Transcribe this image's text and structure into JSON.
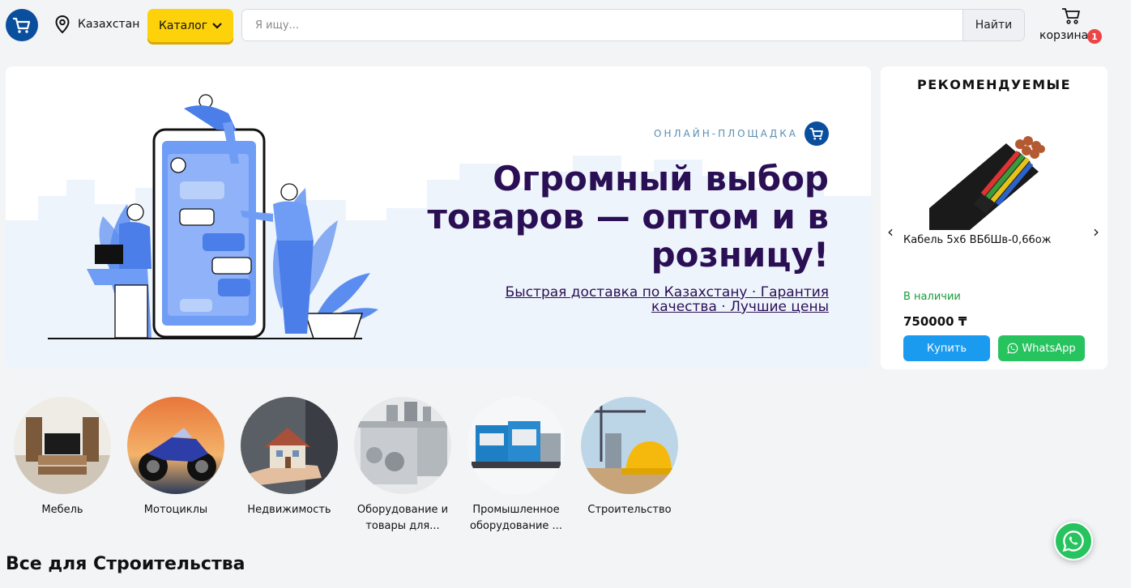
{
  "header": {
    "location": "Казахстан",
    "catalog_label": "Каталог",
    "search_placeholder": "Я ищу...",
    "search_button": "Найти",
    "cart_label": "корзина",
    "cart_count": "1"
  },
  "hero": {
    "subtitle": "ОНЛАЙН-ПЛОЩАДКА",
    "title": "Огромный выбор товаров — оптом и в розницу!",
    "text": "Быстрая доставка по Казахстану · Гарантия качества · Лучшие цены"
  },
  "recommended": {
    "title": "РЕКОМЕНДУЕМЫЕ",
    "product_name": "Кабель 5х6 ВБбШв-0,66ож",
    "stock": "В наличии",
    "price": "750000 ₸",
    "buy_label": "Купить",
    "whatsapp_label": "WhatsApp"
  },
  "categories": [
    {
      "label": "Мебель"
    },
    {
      "label": "Мотоциклы"
    },
    {
      "label": "Недвижимость"
    },
    {
      "label": "Оборудование и товары для..."
    },
    {
      "label": "Промышленное оборудование ..."
    },
    {
      "label": "Строительство"
    }
  ],
  "section_title": "Все для Строительства",
  "colors": {
    "brand": "#0a4f9e",
    "catalog": "#fdd20b",
    "hero_title": "#2b0f55",
    "buy": "#1a9bf0",
    "whatsapp": "#27c35e",
    "in_stock": "#189c3a"
  }
}
